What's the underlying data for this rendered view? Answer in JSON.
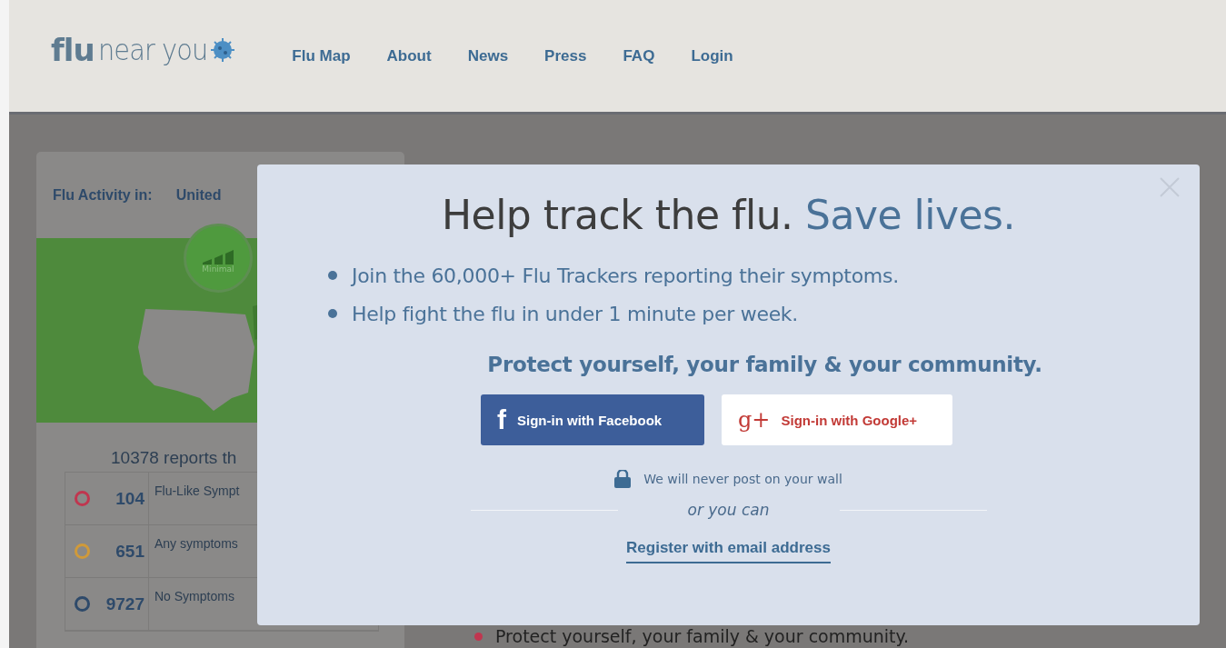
{
  "header": {
    "logo": {
      "bold": "flu",
      "light": "near you"
    },
    "nav": [
      {
        "label": "Flu Map"
      },
      {
        "label": "About"
      },
      {
        "label": "News"
      },
      {
        "label": "Press"
      },
      {
        "label": "FAQ"
      },
      {
        "label": "Login"
      }
    ]
  },
  "activity_card": {
    "label": "Flu Activity in:",
    "region": "United",
    "badge": "Minimal",
    "reports": "10378 reports th",
    "rows": [
      {
        "color": "#c0364f",
        "count": "104",
        "label": "Flu-Like Sympt"
      },
      {
        "color": "#d09a3a",
        "count": "651",
        "label": "Any symptoms"
      },
      {
        "color": "#2e4a6a",
        "count": "9727",
        "label": "No Symptoms"
      }
    ]
  },
  "background_text": "Protect yourself, your family & your community.",
  "modal": {
    "headline": "Help track the flu.",
    "headline_emphasis": "Save lives.",
    "bullets": [
      "Join the 60,000+ Flu Trackers reporting their symptoms.",
      "Help fight the flu in under 1 minute per week."
    ],
    "tagline": "Protect yourself, your family & your community.",
    "buttons": [
      {
        "kind": "facebook",
        "icon": "f",
        "label": "Sign-in with Facebook"
      },
      {
        "kind": "google",
        "icon": "g+",
        "label": "Sign-in with Google+"
      }
    ],
    "privacy_note": "We will never post on your wall",
    "divider_text": "or you can",
    "register_link": "Register with email address"
  }
}
